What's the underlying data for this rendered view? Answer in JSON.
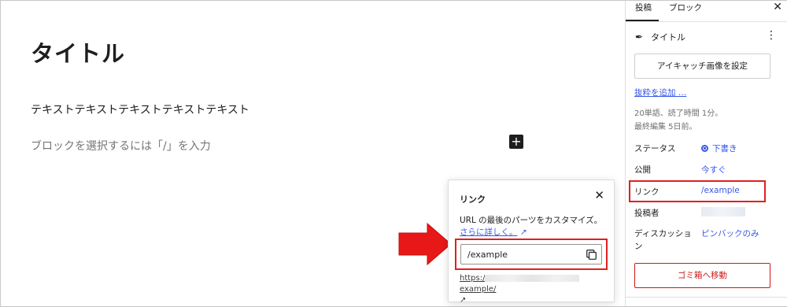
{
  "editor": {
    "title": "タイトル",
    "paragraph": "テキストテキストテキストテキストテキスト",
    "placeholder": "ブロックを選択するには「/」を入力",
    "inserter_symbol": "+"
  },
  "popover": {
    "title": "リンク",
    "close_symbol": "✕",
    "description": "URL の最後のパーツをカスタマイズ。",
    "learn_more": "さらに詳しく。",
    "external_symbol": "↗",
    "slug_value": "/example",
    "url_prefix": "https:/",
    "url_suffix": "example/",
    "url_external_symbol": "↗",
    "icons": {
      "copy": "copy-icon",
      "close": "close-icon"
    }
  },
  "sidebar": {
    "tabs": [
      {
        "label": "投稿",
        "active": true
      },
      {
        "label": "ブロック",
        "active": false
      }
    ],
    "close_symbol": "✕",
    "post_title": "タイトル",
    "more_symbol": "⋮",
    "featured_image_button": "アイキャッチ画像を設定",
    "add_excerpt": "抜粋を追加 …",
    "meta_line1": "20単語、読了時間 1分。",
    "meta_line2": "最終編集 5日前。",
    "rows": {
      "status": {
        "label": "ステータス",
        "value": "下書き"
      },
      "publish": {
        "label": "公開",
        "value": "今すぐ"
      },
      "link": {
        "label": "リンク",
        "value": "/example"
      },
      "author": {
        "label": "投稿者"
      },
      "discussion": {
        "label_line1": "ディスカッショ",
        "label_line2": "ン",
        "value": "ピンバックのみ"
      }
    },
    "trash_button": "ゴミ箱へ移動"
  },
  "colors": {
    "accent": "#3858e9",
    "highlight": "#e02020",
    "danger": "#cc1818",
    "text": "#1e1e1e"
  }
}
